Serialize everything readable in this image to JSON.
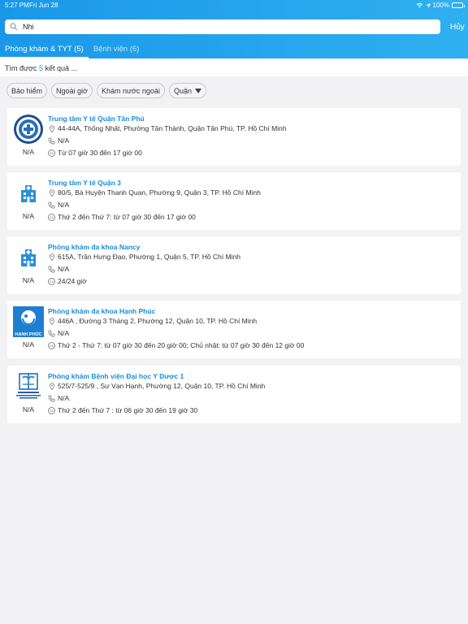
{
  "status_bar": {
    "time": "5:27 PM",
    "date": "Fri Jun 28",
    "battery": "100%"
  },
  "search": {
    "value": "Nhi",
    "cancel_label": "Hủy"
  },
  "tabs": [
    {
      "label": "Phòng khám & TYT (5)",
      "active": true
    },
    {
      "label": "Bệnh viện (6)",
      "active": false
    }
  ],
  "results": {
    "prefix": "Tìm được ",
    "count": "5",
    "suffix": " kết quả ..."
  },
  "filters": {
    "insurance": "Bảo hiểm",
    "after_hours": "Ngoài giờ",
    "abroad": "Khám nước ngoài",
    "district": "Quận"
  },
  "clinics": [
    {
      "name": "Trung tâm Y tế Quận Tân Phú",
      "address": "44-44A, Thống Nhất, Phường Tân Thành, Quận Tân Phú, TP. Hồ Chí Minh",
      "phone": "N/A",
      "hours": "Từ 07 giờ 30 đến 17 giờ 00",
      "rating": "N/A",
      "logo": "tanphu-seal"
    },
    {
      "name": "Trung tâm Y tế Quận 3",
      "address": "80/5, Bà Huyện Thanh Quan, Phường 9, Quận 3, TP. Hồ Chí Minh",
      "phone": "N/A",
      "hours": "Thứ 2 đến Thứ 7: từ 07 giờ 30 đến 17 giờ 00",
      "rating": "N/A",
      "logo": "hospital-building-icon"
    },
    {
      "name": "Phòng khám đa khoa Nancy",
      "address": "615A, Trần Hưng Đạo, Phường 1, Quận 5, TP. Hồ Chí Minh",
      "phone": "N/A",
      "hours": "24/24 giờ",
      "rating": "N/A",
      "logo": "hospital-building-icon"
    },
    {
      "name": "Phòng khám đa khoa Hạnh Phúc",
      "address": "446A , Đường 3 Tháng 2, Phường 12, Quận 10, TP. Hồ Chí Minh",
      "phone": "N/A",
      "hours": "Thứ 2 - Thứ 7: từ 07 giờ 30 đến 20 giờ 00; Chủ nhật: từ 07 giờ 30 đến 12 giờ 00",
      "rating": "N/A",
      "logo": "hanhphuc-logo",
      "logo_text": "HẠNH PHÚC"
    },
    {
      "name": "Phòng khám Bệnh viện Đại học Y Dược 1",
      "address": "525/7-525/9 , Sư Vạn Hạnh, Phường 12, Quận 10, TP. Hồ Chí Minh",
      "phone": "N/A",
      "hours": "Thứ 2 đến Thứ 7 : từ 06 giờ 30 đến 19 giờ 30",
      "rating": "N/A",
      "logo": "umc-logo"
    }
  ],
  "colors": {
    "header": "#1a98e8",
    "accent": "#1a8cd8",
    "background": "#f2f2f4"
  }
}
